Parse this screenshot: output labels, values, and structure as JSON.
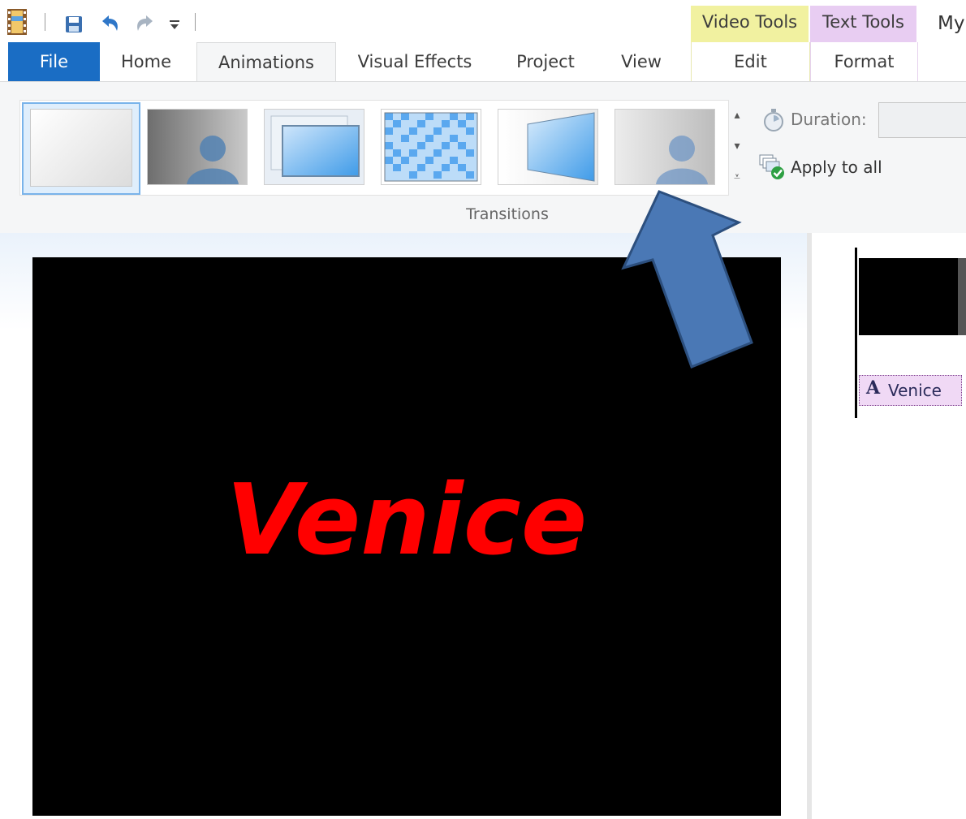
{
  "colors": {
    "accent_blue": "#1a6dc4",
    "video_tools_bg": "#f1f1a0",
    "text_tools_bg": "#e8cdf2",
    "preview_text": "#ff0000",
    "arrow_fill": "#4a78b5"
  },
  "quick_access": {
    "icons": [
      "movie-maker-icon",
      "save-icon",
      "undo-icon",
      "redo-icon",
      "customize-qat-icon"
    ]
  },
  "contextual": {
    "video_tools": "Video Tools",
    "text_tools": "Text Tools"
  },
  "window": {
    "title_partial": "My"
  },
  "tabs": {
    "file": "File",
    "home": "Home",
    "animations": "Animations",
    "visual_effects": "Visual Effects",
    "project": "Project",
    "view": "View",
    "edit": "Edit",
    "format": "Format"
  },
  "ribbon": {
    "transitions_group_label": "Transitions",
    "transitions": [
      {
        "name": "no-transition",
        "selected": true
      },
      {
        "name": "crossfade"
      },
      {
        "name": "zoom"
      },
      {
        "name": "mosaic"
      },
      {
        "name": "perspective"
      },
      {
        "name": "fade"
      }
    ],
    "duration_label": "Duration:",
    "duration_value": "",
    "apply_to_all": "Apply to all"
  },
  "preview": {
    "text": "Venice"
  },
  "storyboard": {
    "caption": "Venice"
  }
}
